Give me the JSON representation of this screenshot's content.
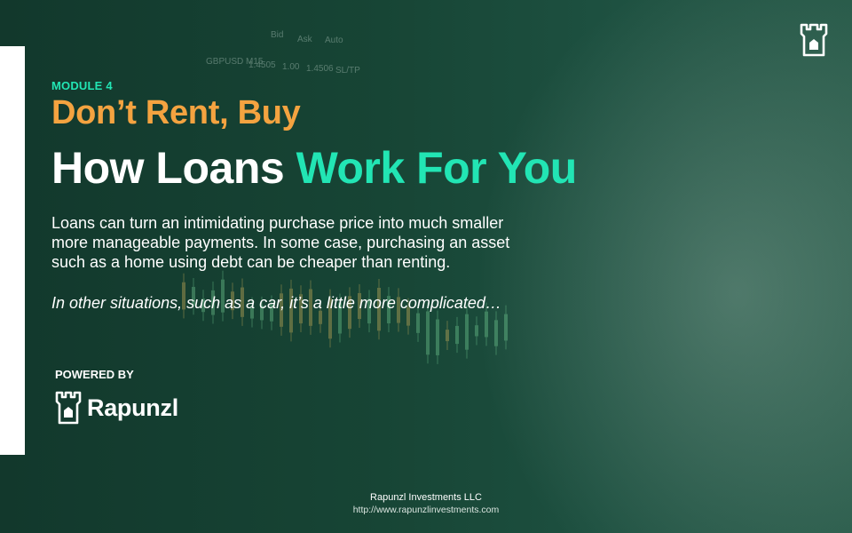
{
  "slide": {
    "module_label": "MODULE 4",
    "title_line1": "Don’t Rent, Buy",
    "title_line2_white": "How Loans",
    "title_line2_green": "Work For You",
    "paragraph_lines": [
      "Loans can turn an intimidating purchase price into much smaller",
      "more manageable payments. In some case, purchasing an asset",
      "such as a home using debt can be cheaper than renting."
    ],
    "italic_line": "In other situations,  such as a car, it’s a little more complicated…"
  },
  "background_ticker": {
    "labels": [
      "Bid",
      "Ask",
      "Auto",
      "GBPUSD M15",
      "1.4505",
      "1.00",
      "1.4506",
      "SL/TP"
    ]
  },
  "powered_by": {
    "label": "POWERED BY",
    "brand_name": "Rapunzl"
  },
  "footer": {
    "company": "Rapunzl Investments LLC",
    "url": "http://www.rapunzlinvestments.com"
  },
  "colors": {
    "accent_green": "#22e5b4",
    "accent_orange": "#f4a340",
    "background": "#174535",
    "text": "#ffffff"
  },
  "icons": {
    "top_right": "rapunzl-tower-icon",
    "brand": "rapunzl-tower-icon"
  }
}
